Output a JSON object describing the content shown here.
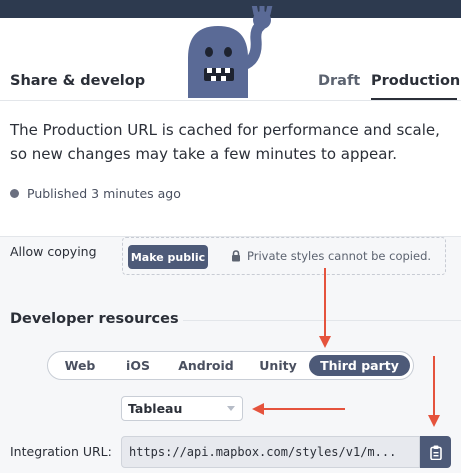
{
  "header": {
    "title": "Share & develop",
    "tabs": [
      {
        "label": "Draft",
        "active": false
      },
      {
        "label": "Production",
        "active": true
      }
    ]
  },
  "description": "The Production URL is cached for performance and scale, so new changes may take a few minutes to appear.",
  "status": {
    "published": "Published 3 minutes ago"
  },
  "allow_copying": {
    "label": "Allow copying",
    "button_label": "Make public",
    "note": "Private styles cannot be copied."
  },
  "developer_resources": {
    "title": "Developer resources",
    "platforms": [
      {
        "label": "Web",
        "active": false
      },
      {
        "label": "iOS",
        "active": false
      },
      {
        "label": "Android",
        "active": false
      },
      {
        "label": "Unity",
        "active": false
      },
      {
        "label": "Third party",
        "active": true
      }
    ],
    "select": {
      "value": "Tableau"
    },
    "integration_url": {
      "label": "Integration URL:",
      "value": "https://api.mapbox.com/styles/v1/m..."
    }
  },
  "icons": {
    "mascot": "mascot-illustration",
    "published": "status-dot-icon",
    "lock": "lock-icon",
    "dropdown": "chevron-down-icon",
    "copy": "clipboard-icon"
  },
  "colors": {
    "topbar": "#2d3a4f",
    "accent": "#4d5a78",
    "mascot": "#5a6a96",
    "annotation_arrow": "#e5533d"
  }
}
